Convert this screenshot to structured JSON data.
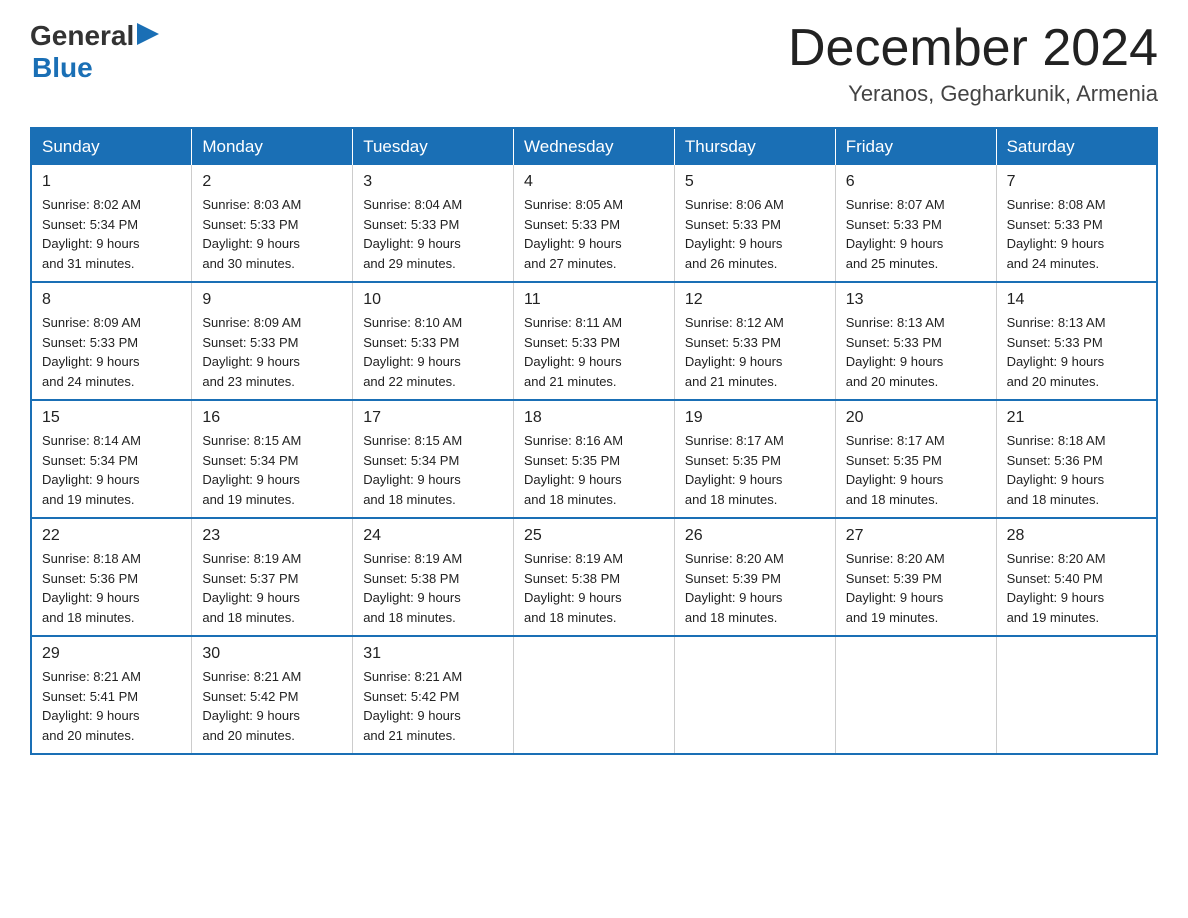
{
  "logo": {
    "general": "General",
    "arrow": "▶",
    "blue": "Blue"
  },
  "title": {
    "month_year": "December 2024",
    "location": "Yeranos, Gegharkunik, Armenia"
  },
  "headers": [
    "Sunday",
    "Monday",
    "Tuesday",
    "Wednesday",
    "Thursday",
    "Friday",
    "Saturday"
  ],
  "weeks": [
    [
      {
        "day": "1",
        "sunrise": "8:02 AM",
        "sunset": "5:34 PM",
        "daylight": "9 hours and 31 minutes."
      },
      {
        "day": "2",
        "sunrise": "8:03 AM",
        "sunset": "5:33 PM",
        "daylight": "9 hours and 30 minutes."
      },
      {
        "day": "3",
        "sunrise": "8:04 AM",
        "sunset": "5:33 PM",
        "daylight": "9 hours and 29 minutes."
      },
      {
        "day": "4",
        "sunrise": "8:05 AM",
        "sunset": "5:33 PM",
        "daylight": "9 hours and 27 minutes."
      },
      {
        "day": "5",
        "sunrise": "8:06 AM",
        "sunset": "5:33 PM",
        "daylight": "9 hours and 26 minutes."
      },
      {
        "day": "6",
        "sunrise": "8:07 AM",
        "sunset": "5:33 PM",
        "daylight": "9 hours and 25 minutes."
      },
      {
        "day": "7",
        "sunrise": "8:08 AM",
        "sunset": "5:33 PM",
        "daylight": "9 hours and 24 minutes."
      }
    ],
    [
      {
        "day": "8",
        "sunrise": "8:09 AM",
        "sunset": "5:33 PM",
        "daylight": "9 hours and 24 minutes."
      },
      {
        "day": "9",
        "sunrise": "8:09 AM",
        "sunset": "5:33 PM",
        "daylight": "9 hours and 23 minutes."
      },
      {
        "day": "10",
        "sunrise": "8:10 AM",
        "sunset": "5:33 PM",
        "daylight": "9 hours and 22 minutes."
      },
      {
        "day": "11",
        "sunrise": "8:11 AM",
        "sunset": "5:33 PM",
        "daylight": "9 hours and 21 minutes."
      },
      {
        "day": "12",
        "sunrise": "8:12 AM",
        "sunset": "5:33 PM",
        "daylight": "9 hours and 21 minutes."
      },
      {
        "day": "13",
        "sunrise": "8:13 AM",
        "sunset": "5:33 PM",
        "daylight": "9 hours and 20 minutes."
      },
      {
        "day": "14",
        "sunrise": "8:13 AM",
        "sunset": "5:33 PM",
        "daylight": "9 hours and 20 minutes."
      }
    ],
    [
      {
        "day": "15",
        "sunrise": "8:14 AM",
        "sunset": "5:34 PM",
        "daylight": "9 hours and 19 minutes."
      },
      {
        "day": "16",
        "sunrise": "8:15 AM",
        "sunset": "5:34 PM",
        "daylight": "9 hours and 19 minutes."
      },
      {
        "day": "17",
        "sunrise": "8:15 AM",
        "sunset": "5:34 PM",
        "daylight": "9 hours and 18 minutes."
      },
      {
        "day": "18",
        "sunrise": "8:16 AM",
        "sunset": "5:35 PM",
        "daylight": "9 hours and 18 minutes."
      },
      {
        "day": "19",
        "sunrise": "8:17 AM",
        "sunset": "5:35 PM",
        "daylight": "9 hours and 18 minutes."
      },
      {
        "day": "20",
        "sunrise": "8:17 AM",
        "sunset": "5:35 PM",
        "daylight": "9 hours and 18 minutes."
      },
      {
        "day": "21",
        "sunrise": "8:18 AM",
        "sunset": "5:36 PM",
        "daylight": "9 hours and 18 minutes."
      }
    ],
    [
      {
        "day": "22",
        "sunrise": "8:18 AM",
        "sunset": "5:36 PM",
        "daylight": "9 hours and 18 minutes."
      },
      {
        "day": "23",
        "sunrise": "8:19 AM",
        "sunset": "5:37 PM",
        "daylight": "9 hours and 18 minutes."
      },
      {
        "day": "24",
        "sunrise": "8:19 AM",
        "sunset": "5:38 PM",
        "daylight": "9 hours and 18 minutes."
      },
      {
        "day": "25",
        "sunrise": "8:19 AM",
        "sunset": "5:38 PM",
        "daylight": "9 hours and 18 minutes."
      },
      {
        "day": "26",
        "sunrise": "8:20 AM",
        "sunset": "5:39 PM",
        "daylight": "9 hours and 18 minutes."
      },
      {
        "day": "27",
        "sunrise": "8:20 AM",
        "sunset": "5:39 PM",
        "daylight": "9 hours and 19 minutes."
      },
      {
        "day": "28",
        "sunrise": "8:20 AM",
        "sunset": "5:40 PM",
        "daylight": "9 hours and 19 minutes."
      }
    ],
    [
      {
        "day": "29",
        "sunrise": "8:21 AM",
        "sunset": "5:41 PM",
        "daylight": "9 hours and 20 minutes."
      },
      {
        "day": "30",
        "sunrise": "8:21 AM",
        "sunset": "5:42 PM",
        "daylight": "9 hours and 20 minutes."
      },
      {
        "day": "31",
        "sunrise": "8:21 AM",
        "sunset": "5:42 PM",
        "daylight": "9 hours and 21 minutes."
      },
      null,
      null,
      null,
      null
    ]
  ],
  "labels": {
    "sunrise": "Sunrise: ",
    "sunset": "Sunset: ",
    "daylight": "Daylight: "
  }
}
